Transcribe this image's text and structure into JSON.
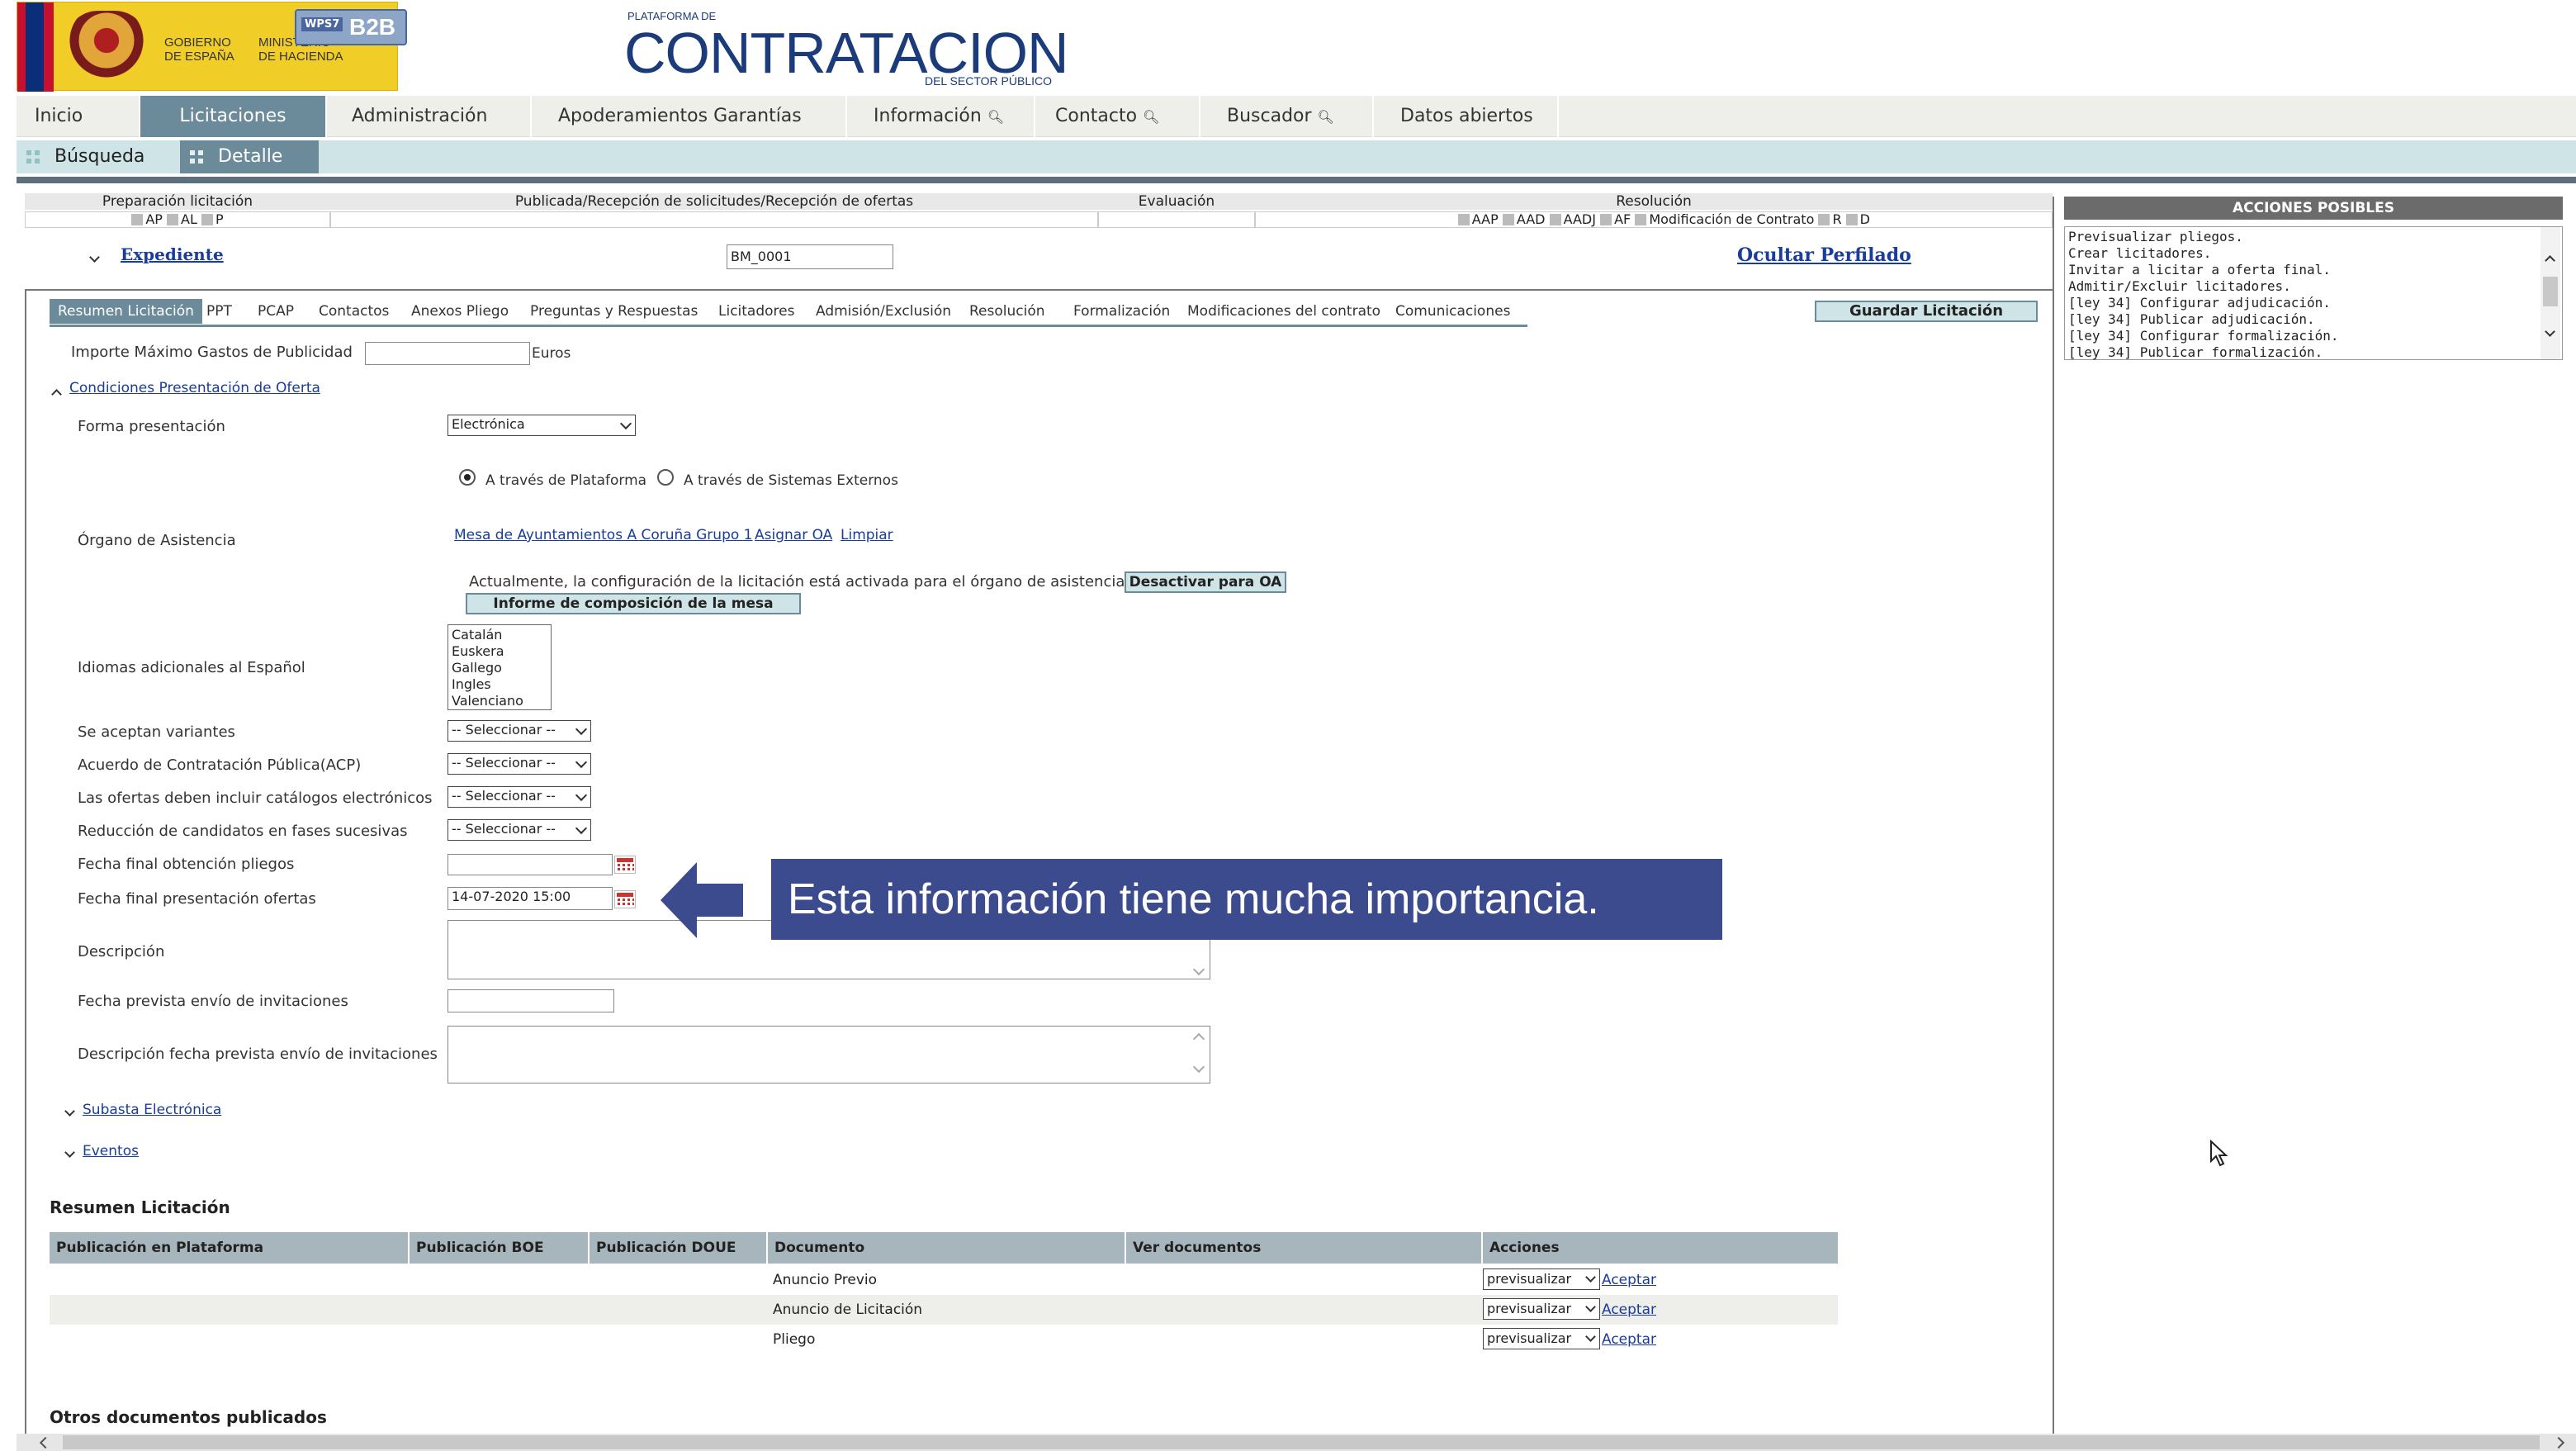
{
  "header": {
    "gob_text": "GOBIERNO\nDE ESPAÑA",
    "min_text": "MINISTERIO\nDE HACIENDA",
    "b2b_label": "B2B",
    "wps_label": "WPS7",
    "platform_small_top": "PLATAFORMA DE",
    "platform_title": "CONTRATACION",
    "platform_small_bottom": "DEL SECTOR PÚBLICO"
  },
  "nav": {
    "items": [
      {
        "label": "Inicio"
      },
      {
        "label": "Licitaciones"
      },
      {
        "label": "Administración"
      },
      {
        "label": "Apoderamientos Garantías"
      },
      {
        "label": "Información"
      },
      {
        "label": "Contacto"
      },
      {
        "label": "Buscador"
      },
      {
        "label": "Datos abiertos"
      }
    ],
    "active": "Licitaciones"
  },
  "subnav": {
    "items": [
      {
        "label": "Búsqueda"
      },
      {
        "label": "Detalle"
      }
    ]
  },
  "phases": {
    "preparacion": "Preparación licitación",
    "publicada": "Publicada/Recepción de solicitudes/Recepción de ofertas",
    "evaluacion": "Evaluación",
    "resolucion": "Resolución",
    "prep_checks": [
      "AP",
      "AL",
      "P"
    ],
    "res_checks": [
      "AAP",
      "AAD",
      "AADJ",
      "AF",
      "Modificación de Contrato",
      "R",
      "D"
    ]
  },
  "expediente": {
    "label": "Expediente",
    "value": "BM_0001",
    "ocultar": "Ocultar Perfilado"
  },
  "tabs": [
    {
      "label": "Resumen Licitación"
    },
    {
      "label": "PPT"
    },
    {
      "label": "PCAP"
    },
    {
      "label": "Contactos"
    },
    {
      "label": "Anexos Pliego"
    },
    {
      "label": "Preguntas y Respuestas"
    },
    {
      "label": "Licitadores"
    },
    {
      "label": "Admisión/Exclusión"
    },
    {
      "label": "Resolución"
    },
    {
      "label": "Formalización"
    },
    {
      "label": "Modificaciones del contrato"
    },
    {
      "label": "Comunicaciones"
    }
  ],
  "guardar": "Guardar Licitación",
  "form": {
    "importe_label": "Importe Máximo Gastos de Publicidad",
    "importe_unit": "Euros",
    "condiciones_link": "Condiciones Presentación de Oferta",
    "forma_label": "Forma presentación",
    "forma_value": "Electrónica",
    "radio_plataforma": "A través de Plataforma",
    "radio_externos": "A través de Sistemas Externos",
    "organo_label": "Órgano de Asistencia",
    "organo_link": "Mesa de Ayuntamientos A Coruña Grupo 1",
    "asignar_link": "Asignar OA",
    "limpiar_link": "Limpiar",
    "actualmente_text": "Actualmente, la configuración de la licitación está activada para el órgano de asistencia",
    "desactivar_btn": "Desactivar para OA",
    "informe_btn": "Informe de composición de la mesa",
    "idiomas_label": "Idiomas adicionales al Español",
    "idiomas": [
      "Catalán",
      "Euskera",
      "Gallego",
      "Ingles",
      "Valenciano"
    ],
    "variantes_label": "Se aceptan variantes",
    "acp_label": "Acuerdo de Contratación Pública(ACP)",
    "catalogos_label": "Las ofertas deben incluir catálogos electrónicos",
    "reduccion_label": "Reducción de candidatos en fases sucesivas",
    "select_placeholder": "-- Seleccionar --",
    "fecha_pliegos_label": "Fecha final obtención pliegos",
    "fecha_ofertas_label": "Fecha final presentación ofertas",
    "fecha_ofertas_value": "14-07-2020 15:00",
    "descripcion_label": "Descripción",
    "fecha_invitaciones_label": "Fecha prevista envío de invitaciones",
    "desc_fecha_label": "Descripción fecha prevista envío de invitaciones",
    "subasta_link": "Subasta Electrónica",
    "eventos_link": "Eventos"
  },
  "callout": "Esta información tiene mucha importancia.",
  "side": {
    "title": "ACCIONES POSIBLES",
    "actions": [
      "Previsualizar pliegos.",
      "Crear licitadores.",
      "Invitar a licitar a oferta final.",
      "Admitir/Excluir licitadores.",
      "[ley 34] Configurar adjudicación.",
      "[ley 34] Publicar adjudicación.",
      "[ley 34] Configurar formalización.",
      "[ley 34] Publicar formalización."
    ]
  },
  "resumen": {
    "title": "Resumen Licitación",
    "headers": [
      "Publicación en Plataforma",
      "Publicación BOE",
      "Publicación DOUE",
      "Documento",
      "Ver documentos",
      "Acciones"
    ],
    "rows": [
      {
        "documento": "Anuncio Previo",
        "accion": "previsualizar",
        "aceptar": "Aceptar"
      },
      {
        "documento": "Anuncio de Licitación",
        "accion": "previsualizar",
        "aceptar": "Aceptar"
      },
      {
        "documento": "Pliego",
        "accion": "previsualizar",
        "aceptar": "Aceptar"
      }
    ]
  },
  "otros_title": "Otros documentos publicados"
}
